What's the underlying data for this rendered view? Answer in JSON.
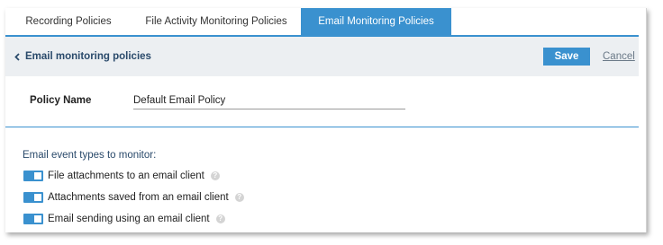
{
  "tabs": [
    {
      "label": "Recording Policies",
      "active": false
    },
    {
      "label": "File Activity Monitoring Policies",
      "active": false
    },
    {
      "label": "Email Monitoring Policies",
      "active": true
    }
  ],
  "header": {
    "back_label": "Email monitoring policies",
    "save_label": "Save",
    "cancel_label": "Cancel"
  },
  "policy": {
    "name_label": "Policy Name",
    "name_value": "Default Email Policy"
  },
  "events": {
    "title": "Email event types to monitor:",
    "items": [
      {
        "label": "File attachments to an email client",
        "enabled": true
      },
      {
        "label": "Attachments saved from an email client",
        "enabled": true
      },
      {
        "label": "Email sending using an email client",
        "enabled": true
      }
    ]
  },
  "icons": {
    "back": "chevron-left-icon",
    "help": "question-circle-icon"
  },
  "colors": {
    "accent": "#3a91cf",
    "header_bg": "#eceff2",
    "title_text": "#2a4a6b"
  }
}
